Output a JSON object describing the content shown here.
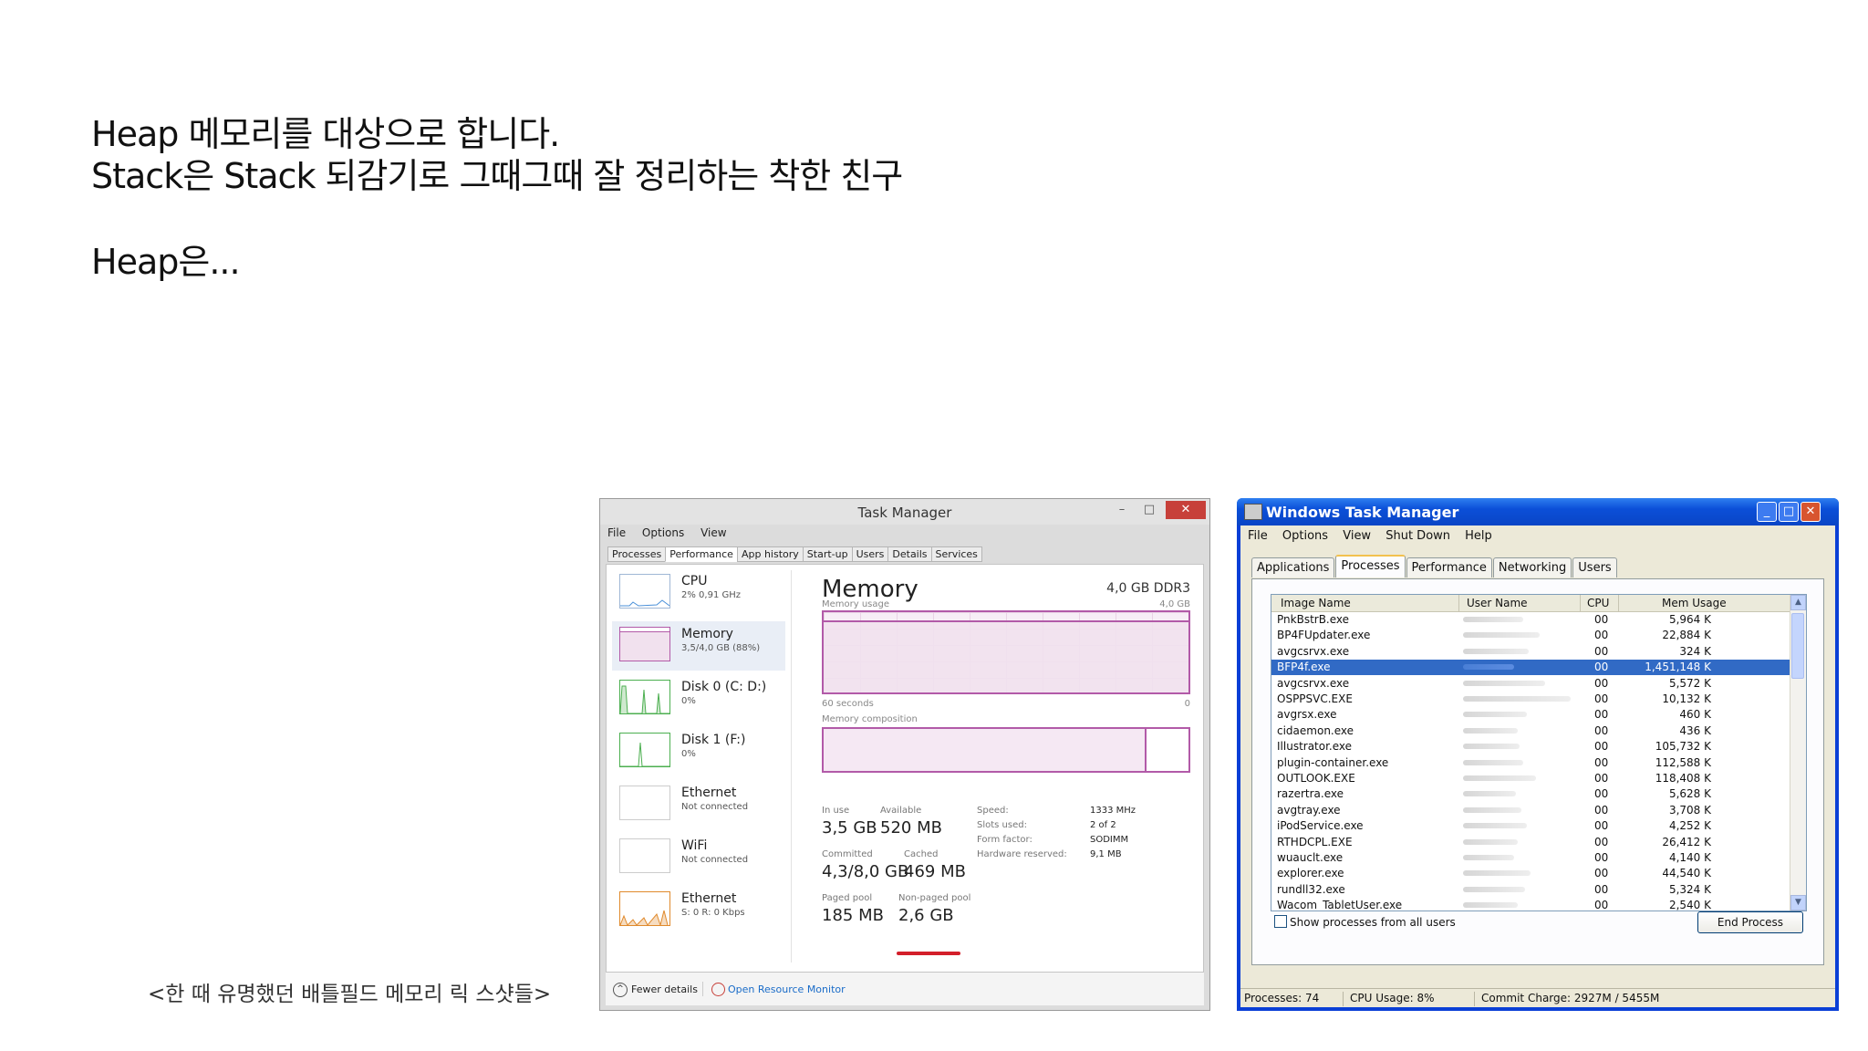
{
  "slide": {
    "line1": "Heap 메모리를 대상으로 합니다.",
    "line2": "Stack은 Stack 되감기로 그때그때 잘 정리하는 착한 친구",
    "line3": "Heap은...",
    "caption": "<한 때 유명했던 배틀필드 메모리 릭 스샷들>"
  },
  "win8": {
    "title": "Task Manager",
    "menu": [
      "File",
      "Options",
      "View"
    ],
    "tabs": [
      "Processes",
      "Performance",
      "App history",
      "Start-up",
      "Users",
      "Details",
      "Services"
    ],
    "active_tab": "Performance",
    "sidebar": [
      {
        "name": "CPU",
        "sub": "2% 0,91 GHz"
      },
      {
        "name": "Memory",
        "sub": "3,5/4,0 GB (88%)"
      },
      {
        "name": "Disk 0 (C: D:)",
        "sub": "0%"
      },
      {
        "name": "Disk 1 (F:)",
        "sub": "0%"
      },
      {
        "name": "Ethernet",
        "sub": "Not connected"
      },
      {
        "name": "WiFi",
        "sub": "Not connected"
      },
      {
        "name": "Ethernet",
        "sub": "S: 0 R: 0 Kbps"
      }
    ],
    "memory_title": "Memory",
    "memory_spec": "4,0 GB DDR3",
    "usage_label": "Memory usage",
    "usage_max": "4,0 GB",
    "usage_percent": 88,
    "seconds_label": "60 seconds",
    "zero_label": "0",
    "composition_label": "Memory composition",
    "stats": {
      "in_use_label": "In use",
      "in_use": "3,5 GB",
      "available_label": "Available",
      "available": "520 MB",
      "committed_label": "Committed",
      "committed": "4,3/8,0 GB",
      "cached_label": "Cached",
      "cached": "469 MB",
      "paged_label": "Paged pool",
      "paged": "185 MB",
      "nonpaged_label": "Non-paged pool",
      "nonpaged": "2,6 GB"
    },
    "kv": {
      "speed_label": "Speed:",
      "speed": "1333 MHz",
      "slots_label": "Slots used:",
      "slots": "2 of 2",
      "form_label": "Form factor:",
      "form": "SODIMM",
      "hw_label": "Hardware reserved:",
      "hw": "9,1 MB"
    },
    "fewer_details": "Fewer details",
    "resource_monitor": "Open Resource Monitor",
    "accent": "#b25aa8",
    "highlight": "#d31f2a"
  },
  "xp": {
    "title": "Windows Task Manager",
    "menu": [
      "File",
      "Options",
      "View",
      "Shut Down",
      "Help"
    ],
    "tabs": [
      "Applications",
      "Processes",
      "Performance",
      "Networking",
      "Users"
    ],
    "active_tab": "Processes",
    "columns": [
      "Image Name",
      "User Name",
      "CPU",
      "Mem Usage"
    ],
    "rows": [
      {
        "name": "PnkBstrB.exe",
        "cpu": "00",
        "mem": "5,964 K"
      },
      {
        "name": "BP4FUpdater.exe",
        "cpu": "00",
        "mem": "22,884 K"
      },
      {
        "name": "avgcsrvx.exe",
        "cpu": "00",
        "mem": "324 K"
      },
      {
        "name": "BFP4f.exe",
        "cpu": "00",
        "mem": "1,451,148 K"
      },
      {
        "name": "avgcsrvx.exe",
        "cpu": "00",
        "mem": "5,572 K"
      },
      {
        "name": "OSPPSVC.EXE",
        "cpu": "00",
        "mem": "10,132 K"
      },
      {
        "name": "avgrsx.exe",
        "cpu": "00",
        "mem": "460 K"
      },
      {
        "name": "cidaemon.exe",
        "cpu": "00",
        "mem": "436 K"
      },
      {
        "name": "Illustrator.exe",
        "cpu": "00",
        "mem": "105,732 K"
      },
      {
        "name": "plugin-container.exe",
        "cpu": "00",
        "mem": "112,588 K"
      },
      {
        "name": "OUTLOOK.EXE",
        "cpu": "00",
        "mem": "118,408 K"
      },
      {
        "name": "razertra.exe",
        "cpu": "00",
        "mem": "5,628 K"
      },
      {
        "name": "avgtray.exe",
        "cpu": "00",
        "mem": "3,708 K"
      },
      {
        "name": "iPodService.exe",
        "cpu": "00",
        "mem": "4,252 K"
      },
      {
        "name": "RTHDCPL.EXE",
        "cpu": "00",
        "mem": "26,412 K"
      },
      {
        "name": "wuauclt.exe",
        "cpu": "00",
        "mem": "4,140 K"
      },
      {
        "name": "explorer.exe",
        "cpu": "00",
        "mem": "44,540 K"
      },
      {
        "name": "rundll32.exe",
        "cpu": "00",
        "mem": "5,324 K"
      },
      {
        "name": "Wacom_TabletUser.exe",
        "cpu": "00",
        "mem": "2,540 K"
      }
    ],
    "selected_row": "BFP4f.exe",
    "show_all": "Show processes from all users",
    "end_process": "End Process",
    "status": {
      "processes": "Processes: 74",
      "cpu": "CPU Usage: 8%",
      "commit": "Commit Charge: 2927M / 5455M"
    },
    "selection_color": "#316ac5",
    "title_color": "#0b4fd8"
  }
}
